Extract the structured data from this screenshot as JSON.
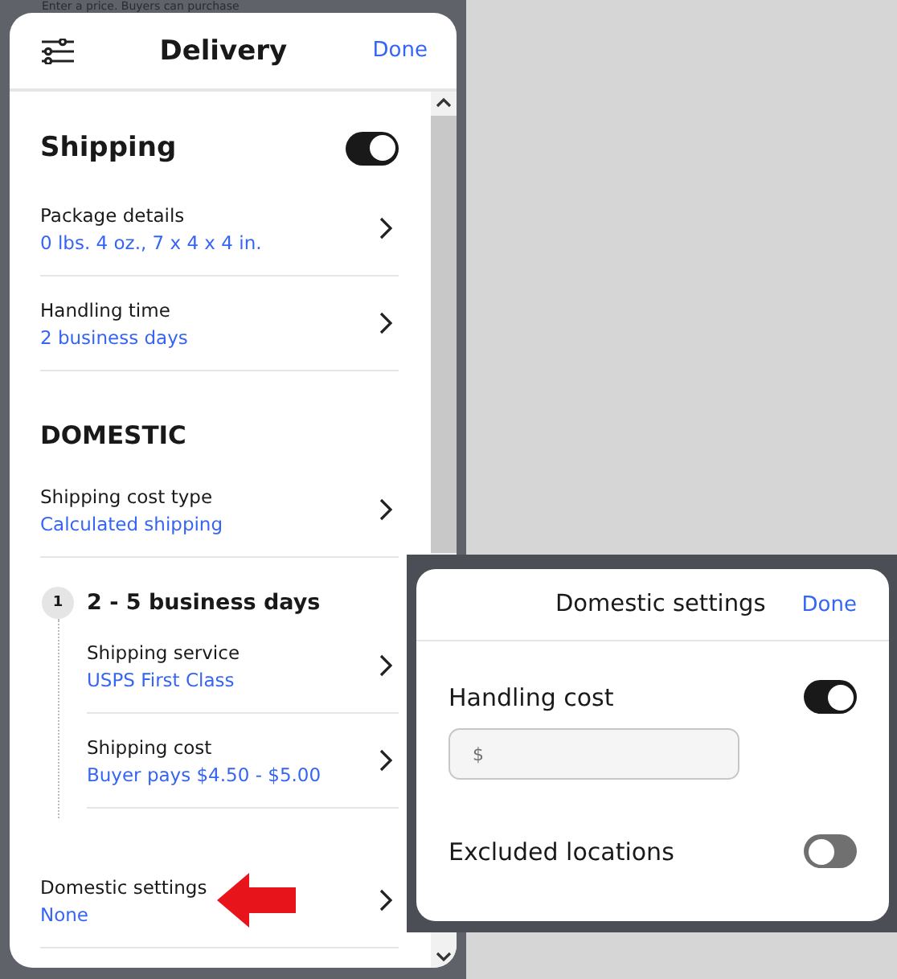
{
  "background": {
    "text": "Enter a price. Buyers can purchase"
  },
  "delivery": {
    "title": "Delivery",
    "done": "Done",
    "shipping": {
      "label": "Shipping",
      "on": true
    },
    "rows": [
      {
        "label": "Package details",
        "value": "0 lbs. 4 oz., 7 x 4 x 4 in."
      },
      {
        "label": "Handling time",
        "value": "2 business days"
      }
    ],
    "section": "DOMESTIC",
    "cost_type": {
      "label": "Shipping cost type",
      "value": "Calculated shipping"
    },
    "step": {
      "number": "1",
      "title": "2 - 5 business days",
      "rows": [
        {
          "label": "Shipping service",
          "value": "USPS First Class"
        },
        {
          "label": "Shipping cost",
          "value": "Buyer pays $4.50 - $5.00"
        }
      ]
    },
    "domestic_settings": {
      "label": "Domestic settings",
      "value": "None"
    }
  },
  "domestic_panel": {
    "title": "Domestic settings",
    "done": "Done",
    "settings": [
      {
        "label": "Handling cost",
        "on": true,
        "field": {
          "placeholder": "$"
        }
      },
      {
        "label": "Excluded locations",
        "on": false
      }
    ]
  }
}
